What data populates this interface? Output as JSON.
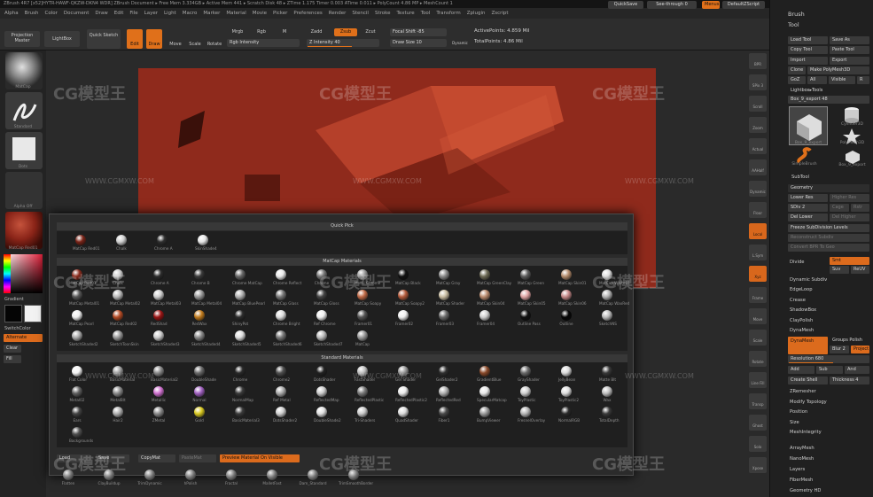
{
  "titlebar": {
    "text": "ZBrush 4R7   [x52]HYTR-HAWF-QKZW-DKN4 WDR]   ZBrush Document   ▸ Free Mem 3.334GB ▸ Active Mem 441 ▸ Scratch Disk 48 ▸ ZTime 1.175 Timer 0.003 ATime 0.011 ▸ PolyCount 4.86 MP ▸ MeshCount 1"
  },
  "menu": [
    "Alpha",
    "Brush",
    "Color",
    "Document",
    "Draw",
    "Edit",
    "File",
    "Layer",
    "Light",
    "Macro",
    "Marker",
    "Material",
    "Movie",
    "Picker",
    "Preferences",
    "Render",
    "Stencil",
    "Stroke",
    "Texture",
    "Tool",
    "Transform",
    "Zplugin",
    "Zscript"
  ],
  "top_right": {
    "quicksave": "QuickSave",
    "seethrough": "See-through 0",
    "menus": "Menus",
    "defaultscript": "DefaultZScript"
  },
  "shelf": {
    "projection_master": "Projection Master",
    "lightbox": "LightBox",
    "quick_sketch": "Quick Sketch",
    "edit": "Edit",
    "draw": "Draw",
    "move": "Move",
    "scale": "Scale",
    "rotate": "Rotate",
    "mrgb": "Mrgb",
    "rgb": "Rgb",
    "m": "M",
    "rgb_intensity": "Rgb Intensity",
    "zadd": "Zadd",
    "zsub": "Zsub",
    "zcut": "Zcut",
    "z_intensity": "Z Intensity 40",
    "focal_shift": "Focal Shift -85",
    "draw_size": "Draw Size 10",
    "dynamic": "Dynamic",
    "active_points": "ActivePoints: 4.859 Mil",
    "total_points": "TotalPoints: 4.86 Mil"
  },
  "left_shelf": {
    "thumb1": "MatCap",
    "thumb2": "Standard",
    "thumb3": "Dots",
    "thumb4": "Alpha Off",
    "thumb5": "Texture Off",
    "material_label": "MatCap Red01",
    "gradient": "Gradient",
    "switch_color": "SwitchColor",
    "alternate": "Alternate",
    "clear": "Clear",
    "fill": "Fill"
  },
  "popup": {
    "quick_pick_title": "Quick Pick",
    "quick_pick": [
      {
        "name": "MatCap Red01",
        "color": "#7a2418"
      },
      {
        "name": "Chalk",
        "color": "#cfcfcf"
      },
      {
        "name": "Chrome A",
        "color": "#303030"
      },
      {
        "name": "SkinShade4",
        "color": "#e6e6e6"
      }
    ],
    "matcap_title": "MatCap Materials",
    "matcap": [
      {
        "name": "MatCap Red01",
        "color": "#8a2a1c"
      },
      {
        "name": "Chalk",
        "color": "#cccccc"
      },
      {
        "name": "Chrome A",
        "color": "#2c2c2c"
      },
      {
        "name": "Chrome B",
        "color": "#3a3a3a"
      },
      {
        "name": "Chrome MatCap",
        "color": "#666"
      },
      {
        "name": "Chrome Reflect",
        "color": "#e8e8e8"
      },
      {
        "name": "Chrome",
        "color": "#777"
      },
      {
        "name": "Metal Chrome",
        "color": "#999"
      },
      {
        "name": "MatCap Black",
        "color": "#111111"
      },
      {
        "name": "MatCap Gray",
        "color": "#8a8a8a"
      },
      {
        "name": "MatCap GreenClay",
        "color": "#6d6a55"
      },
      {
        "name": "MatCap Green",
        "color": "#5c5c5c"
      },
      {
        "name": "MatCap Skin01",
        "color": "#b38a6a"
      },
      {
        "name": "MatCap White01",
        "color": "#dddddd"
      },
      {
        "name": "MatCap Metal01",
        "color": "#575757"
      },
      {
        "name": "MatCap Metal02",
        "color": "#bbbbbb"
      },
      {
        "name": "MatCap Metal03",
        "color": "#cfcfcf"
      },
      {
        "name": "MatCap Metal04",
        "color": "#999999"
      },
      {
        "name": "MatCap BluePearl",
        "color": "#b0b0b0"
      },
      {
        "name": "MatCap Glass",
        "color": "#777777"
      },
      {
        "name": "MatCap Gloss",
        "color": "#444444"
      },
      {
        "name": "MatCap Soapy",
        "color": "#c06a47"
      },
      {
        "name": "MatCap Soapy2",
        "color": "#b45b3c"
      },
      {
        "name": "MatCap Shader",
        "color": "#c9bda2"
      },
      {
        "name": "MatCap Skin04",
        "color": "#b98a6d"
      },
      {
        "name": "MatCap Skin05",
        "color": "#e0a3a3"
      },
      {
        "name": "MatCap Skin06",
        "color": "#c48787"
      },
      {
        "name": "MatCap WaxRed",
        "color": "#b3b3b3"
      },
      {
        "name": "MatCap Pearl",
        "color": "#eeeeee"
      },
      {
        "name": "MatCap Red02",
        "color": "#b44a24"
      },
      {
        "name": "RedShad",
        "color": "#9a1414"
      },
      {
        "name": "RedWax",
        "color": "#c07a1c"
      },
      {
        "name": "ShinyPot",
        "color": "#2c2c2c"
      },
      {
        "name": "Chrome Bright",
        "color": "#dcdcdc"
      },
      {
        "name": "Ref Chrome",
        "color": "#efefef"
      },
      {
        "name": "Framer01",
        "color": "#555555"
      },
      {
        "name": "Framer02",
        "color": "#f0f0f0"
      },
      {
        "name": "Framer03",
        "color": "#6a6a6a"
      },
      {
        "name": "Framer04",
        "color": "#cfcfcf"
      },
      {
        "name": "Outline Pass",
        "color": "#111111"
      },
      {
        "name": "Outline",
        "color": "#050505"
      },
      {
        "name": "SketchNS",
        "color": "#bdbdbd"
      },
      {
        "name": "SketchShaded2",
        "color": "#aaaaaa"
      },
      {
        "name": "SketchToonSkin",
        "color": "#999999"
      },
      {
        "name": "SketchShaded3",
        "color": "#cccccc"
      },
      {
        "name": "SketchShaded4",
        "color": "#888888"
      },
      {
        "name": "SketchShaded5",
        "color": "#dddddd"
      },
      {
        "name": "SketchShaded6",
        "color": "#777777"
      },
      {
        "name": "SketchShaded7",
        "color": "#bbbbbb"
      },
      {
        "name": "MatCap",
        "color": "#999999"
      }
    ],
    "standard_title": "Standard Materials",
    "standard": [
      {
        "name": "Flat Color",
        "color": "#f5f5f5"
      },
      {
        "name": "BasicMaterial",
        "color": "#a0a0a0"
      },
      {
        "name": "BasicMaterial2",
        "color": "#8a8a8a"
      },
      {
        "name": "DoubleShade",
        "color": "#6a6a6a"
      },
      {
        "name": "Chrome",
        "color": "#2a2a2a"
      },
      {
        "name": "Chrome2",
        "color": "#505050"
      },
      {
        "name": "DotsShader",
        "color": "#222222"
      },
      {
        "name": "FastShader",
        "color": "#c0c0c0"
      },
      {
        "name": "Gel Shader",
        "color": "#9a9a9a"
      },
      {
        "name": "GelShader2",
        "color": "#303030"
      },
      {
        "name": "GradientBlue",
        "color": "#8a4a2a"
      },
      {
        "name": "GrayShader",
        "color": "#6a6a6a"
      },
      {
        "name": "JellyBean",
        "color": "#dadada"
      },
      {
        "name": "Matte Blt",
        "color": "#3a3a3a"
      },
      {
        "name": "Metal02",
        "color": "#606060"
      },
      {
        "name": "MetalBlt",
        "color": "#8a8a8a"
      },
      {
        "name": "Metallic",
        "color": "#d070d0"
      },
      {
        "name": "Normal",
        "color": "#a060c0"
      },
      {
        "name": "NormalMap",
        "color": "#3a3a3a"
      },
      {
        "name": "Ref Metal",
        "color": "#aaaaaa"
      },
      {
        "name": "ReflectedMap",
        "color": "#cacaca"
      },
      {
        "name": "ReflectedPlastic",
        "color": "#7a7a7a"
      },
      {
        "name": "ReflectedPlastic2",
        "color": "#ececec"
      },
      {
        "name": "ReflectedRed",
        "color": "#b0b0b0"
      },
      {
        "name": "SpecularMatcap",
        "color": "#e8e8e8"
      },
      {
        "name": "ToyPlastic",
        "color": "#cfcfcf"
      },
      {
        "name": "ToyPlastic2",
        "color": "#dddddd"
      },
      {
        "name": "Wax",
        "color": "#bfbfbf"
      },
      {
        "name": "Ears",
        "color": "#444444"
      },
      {
        "name": "Hair2",
        "color": "#b0b0b0"
      },
      {
        "name": "ZMetal",
        "color": "#8a8a8a"
      },
      {
        "name": "Gold",
        "color": "#d8c820"
      },
      {
        "name": "BasicMaterial3",
        "color": "#3a3a3a"
      },
      {
        "name": "DotsShader2",
        "color": "#cfcfcf"
      },
      {
        "name": "DoubleShade2",
        "color": "#e0e0e0"
      },
      {
        "name": "Tri-Shaders",
        "color": "#cacaca"
      },
      {
        "name": "QuadShader",
        "color": "#dcdcdc"
      },
      {
        "name": "Fiber1",
        "color": "#4a4a4a"
      },
      {
        "name": "BumpViewer",
        "color": "#9a9a9a"
      },
      {
        "name": "FresnelOverlay",
        "color": "#b5b5b5"
      },
      {
        "name": "NormalRGB",
        "color": "#2a2a2a"
      },
      {
        "name": "TotalDepth",
        "color": "#3a3a3a"
      },
      {
        "name": "Backgrounds",
        "color": "#505050"
      }
    ],
    "footer": {
      "load": "Load",
      "save": "Save",
      "copymat": "CopyMat",
      "pastemat": "PasteMat",
      "preview": "Preview Material On Visible"
    }
  },
  "bottom_brushes": [
    "Flatten",
    "ClayBuildup",
    "TrimDynamic",
    "hPolish",
    "Fractal",
    "MalletFast",
    "Dam_Standard",
    "TrimSmoothBorder"
  ],
  "right_tools": [
    "BPR",
    "SPix 3",
    "Scroll",
    "Zoom",
    "Actual",
    "AAHalf",
    "Dynamic Persp",
    "Floor",
    "Local",
    "L.Sym",
    "Xyz",
    "Frame",
    "Move",
    "Scale",
    "Rotate",
    "Line Fill PolyF",
    "Transp",
    "Ghost",
    "Solo",
    "Xpose"
  ],
  "right_panel": {
    "brush": "Brush",
    "tool": "Tool",
    "load_tool": "Load Tool",
    "save_as": "Save As",
    "copy_tool": "Copy Tool",
    "paste_tool": "Paste Tool",
    "import": "Import",
    "export": "Export",
    "clone": "Clone",
    "make_polymesh": "Make PolyMesh3D",
    "goz": "GoZ",
    "all": "All",
    "visible": "Visible",
    "r": "R",
    "lightbox_tools": "Lightbox▸Tools",
    "current_tool": "Box_9_export 48",
    "thumbs": [
      "Box_9_export",
      "Cylinder3D",
      "SimpleBrush",
      "PolyMesh3D",
      "Box_9_export"
    ],
    "subtool": "SubTool",
    "geometry": "Geometry",
    "lower_res": "Lower Res",
    "higher_res": "Higher Res",
    "sdiv": "SDiv 2",
    "cage": "Cage",
    "rstr": "Rstr",
    "del_lower": "Del Lower",
    "del_higher": "Del Higher",
    "freeze_subdiv": "Freeze SubDivision Levels",
    "reconstruct_subdiv": "Reconstruct Subdiv",
    "convert_bpr": "Convert BPR To Geo",
    "divide": "Divide",
    "smt": "Smt",
    "suv": "Suv",
    "rsmt": "ReUV",
    "dynamic_subdiv": "Dynamic Subdiv",
    "edgeloop": "EdgeLoop",
    "crease": "Crease",
    "shadowbox": "ShadowBox",
    "claypolish": "ClayPolish",
    "dynamesh_title": "DynaMesh",
    "dynamesh": "DynaMesh",
    "groups": "Groups",
    "polish": "Polish",
    "blur": "Blur 2",
    "project": "Project",
    "resolution": "Resolution 680",
    "add": "Add",
    "sub": "Sub",
    "and": "And",
    "create_shell": "Create Shell",
    "thickness": "Thickness 4",
    "zremesher": "ZRemesher",
    "modify_topology": "Modify Topology",
    "position": "Position",
    "size": "Size",
    "meshintegrity": "MeshIntegrity",
    "arraymesh": "ArrayMesh",
    "nanomesh": "NanoMesh",
    "layers": "Layers",
    "fibermesh": "FiberMesh",
    "geometry_hd": "Geometry HD"
  },
  "watermark": {
    "logo": "CG模型王",
    "url": "WWW.CGMXW.COM"
  },
  "colors": {
    "accent": "#e0701a",
    "model": "#9c2e1f"
  }
}
